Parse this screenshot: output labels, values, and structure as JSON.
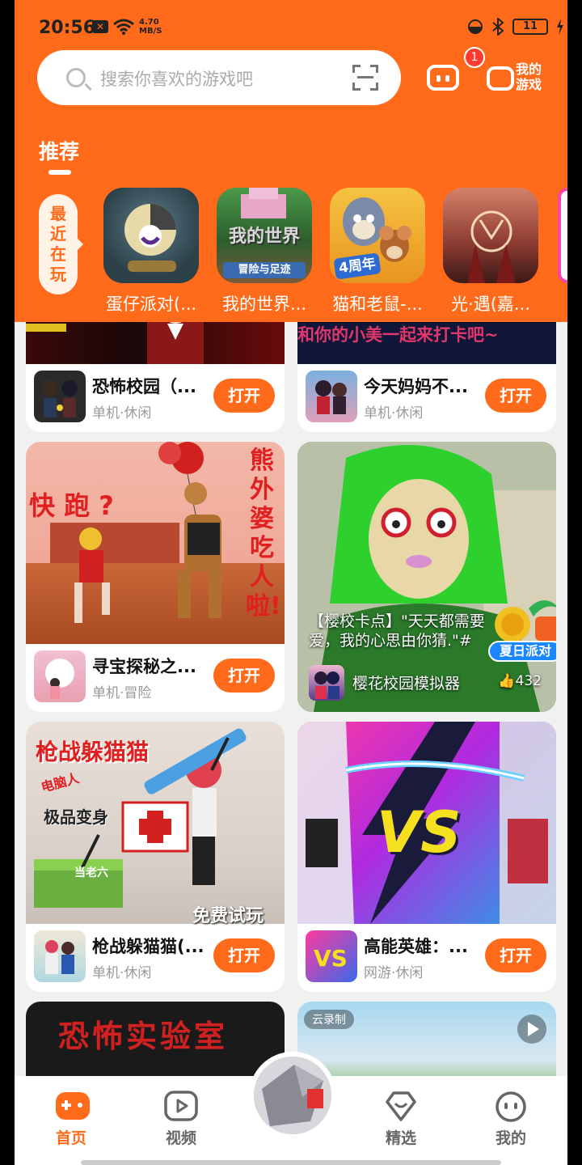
{
  "status_bar": {
    "time": "20:56",
    "speed_value": "4.70",
    "speed_unit": "MB/S",
    "battery": "11"
  },
  "search": {
    "placeholder": "搜索你喜欢的游戏吧"
  },
  "messages": {
    "badge_count": "1"
  },
  "my_games": {
    "label_line1": "我的",
    "label_line2": "游戏"
  },
  "tabs": {
    "active": "推荐"
  },
  "recent": {
    "label_chars": [
      "最",
      "近",
      "在",
      "玩"
    ],
    "games": [
      {
        "name": "蛋仔派对(..."
      },
      {
        "name": "我的世界..."
      },
      {
        "name": "猫和老鼠-..."
      },
      {
        "name": "光·遇(嘉..."
      }
    ],
    "icon_texts": {
      "minecraft_title": "我的世界",
      "minecraft_sub": "冒险与足迹",
      "tomjerry_badge": "4周年"
    }
  },
  "feed": {
    "top_row": [
      {
        "title": "恐怖校园（...",
        "tags": "单机·休闲",
        "button": "打开"
      },
      {
        "title": "今天妈妈不...",
        "tags": "单机·休闲",
        "button": "打开",
        "banner_text": "和你的小美一起来打卡吧~"
      }
    ],
    "card_treasure": {
      "title": "寻宝探秘之...",
      "tags": "单机·冒险",
      "button": "打开",
      "overlay_left": "快 跑 ?",
      "overlay_right": "熊外婆吃人啦!"
    },
    "video_card": {
      "caption": "【樱校卡点】\"天天都需要爱，我的心思由你猜.\"#",
      "game_name": "樱花校园模拟器",
      "likes": "432",
      "badge_label": "夏日派对"
    },
    "card_hideseek": {
      "title": "枪战躲猫猫(...",
      "tags": "单机·休闲",
      "button": "打开",
      "overlay_title": "枪战躲猫猫",
      "overlay_tag1": "电脑人",
      "overlay_tag2": "极品变身",
      "overlay_tag3": "当老六",
      "overlay_bottom": "免费试玩"
    },
    "card_hero": {
      "title": "高能英雄：...",
      "tags": "网游·休闲",
      "button": "打开",
      "vs_text": "VS"
    },
    "bottom_row": [
      {
        "overlay_title": "恐怖实验室"
      },
      {
        "tag": "云录制"
      }
    ]
  },
  "bottom_nav": {
    "items": [
      {
        "label": "首页",
        "active": true
      },
      {
        "label": "视频"
      },
      {
        "label": "精选"
      },
      {
        "label": "我的"
      }
    ]
  },
  "colors": {
    "brand_orange": "#ff6b1a",
    "badge_red": "#ff3b30"
  }
}
